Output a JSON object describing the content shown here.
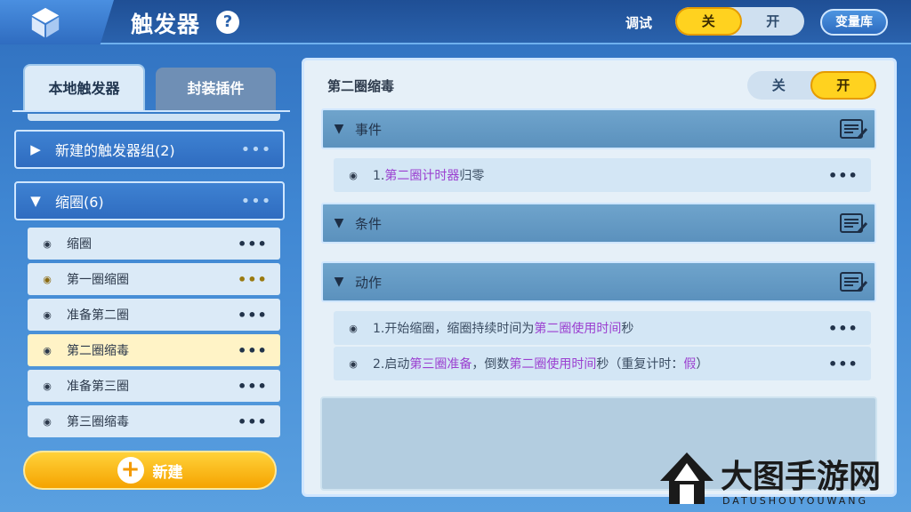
{
  "header": {
    "title": "触发器",
    "help": "?",
    "debug_label": "调试",
    "debug_toggle": {
      "off": "关",
      "on": "开",
      "selected": "off"
    },
    "var_lib": "变量库"
  },
  "tabs": {
    "local": "本地触发器",
    "plugin": "封装插件"
  },
  "groups": [
    {
      "label": "新建的触发器组(2)",
      "expanded": false,
      "dots": "•••"
    },
    {
      "label": "缩圈(6)",
      "expanded": true,
      "dots": "•••"
    }
  ],
  "items": [
    {
      "label": "缩圈",
      "dots": "•••"
    },
    {
      "label": "第一圈缩圈",
      "dots": "•••"
    },
    {
      "label": "准备第二圈",
      "dots": "•••"
    },
    {
      "label": "第二圈缩毒",
      "dots": "•••",
      "selected": true
    },
    {
      "label": "准备第三圈",
      "dots": "•••"
    },
    {
      "label": "第三圈缩毒",
      "dots": "•••"
    }
  ],
  "new_button": "新建",
  "editor": {
    "trigger_name": "第二圈缩毒",
    "enable_toggle": {
      "off": "关",
      "on": "开",
      "selected": "on"
    },
    "sections": {
      "event": "事件",
      "condition": "条件",
      "action": "动作"
    },
    "event_entries": [
      {
        "p1": "1.",
        "h1": "第二圈计时器",
        "p2": "归零"
      }
    ],
    "action_entries": [
      {
        "p1": "1.开始缩圈，缩圈持续时间为",
        "h1": "第二圈使用时间",
        "p2": "秒"
      },
      {
        "p1": "2.启动",
        "h1": "第三圈准备",
        "p2": "，倒数",
        "h2": "第二圈使用时间",
        "p3": "秒（重复计时：",
        "h3": "假",
        "p4": "）"
      }
    ]
  },
  "watermark": {
    "cn": "大图手游网",
    "en": "DATUSHOUYOUWANG"
  },
  "colors": {
    "accent": "#ffd21f",
    "highlight": "#9b3fd0",
    "bar": "#2a62ad"
  }
}
